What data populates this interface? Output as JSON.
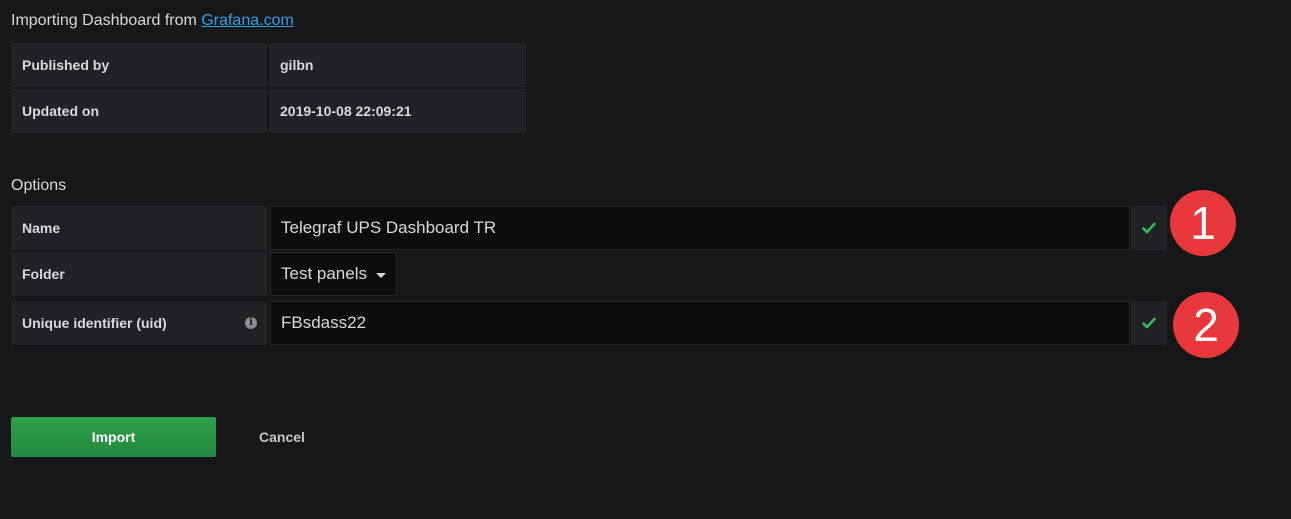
{
  "header": {
    "title_prefix": "Importing Dashboard from",
    "source_link": "Grafana.com"
  },
  "info": [
    {
      "label": "Published by",
      "value": "gilbn"
    },
    {
      "label": "Updated on",
      "value": "2019-10-08 22:09:21"
    }
  ],
  "options": {
    "title": "Options",
    "name": {
      "label": "Name",
      "value": "Telegraf UPS Dashboard TR"
    },
    "folder": {
      "label": "Folder",
      "value": "Test panels"
    },
    "uid": {
      "label": "Unique identifier (uid)",
      "value": "FBsdass22"
    }
  },
  "annotations": {
    "badge1": "1",
    "badge2": "2"
  },
  "actions": {
    "import_label": "Import",
    "cancel_label": "Cancel"
  },
  "colors": {
    "background": "#161719",
    "panel": "#202226",
    "input": "#0b0c0e",
    "link": "#33a2e5",
    "success": "#2fbf5a",
    "import_button": "#299c46",
    "badge": "#e8383c"
  },
  "icons": {
    "valid": "check-icon",
    "folder_dropdown": "caret-down-icon",
    "uid_help": "info-circle-icon"
  }
}
